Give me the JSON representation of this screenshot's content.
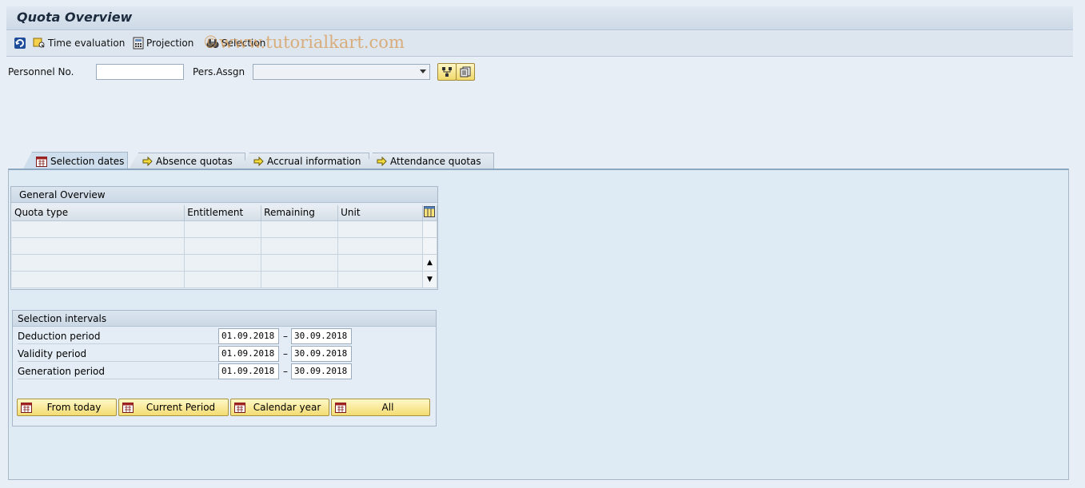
{
  "title": "Quota Overview",
  "watermark": "©www.tutorialkart.com",
  "toolbar": {
    "time_evaluation": "Time evaluation",
    "projection": "Projection",
    "selection": "Selection"
  },
  "header": {
    "personnel_label": "Personnel No.",
    "personnel_value": "",
    "assignment_label": "Pers.Assgn",
    "assignment_value": ""
  },
  "tabs": [
    {
      "label": "Selection dates",
      "active": true
    },
    {
      "label": "Absence quotas",
      "active": false
    },
    {
      "label": "Accrual information",
      "active": false
    },
    {
      "label": "Attendance quotas",
      "active": false
    }
  ],
  "overview": {
    "title": "General Overview",
    "columns": [
      "Quota type",
      "Entitlement",
      "Remaining",
      "Unit"
    ]
  },
  "intervals": {
    "title": "Selection intervals",
    "rows": [
      {
        "label": "Deduction period",
        "from": "01.09.2018",
        "to": "30.09.2018"
      },
      {
        "label": "Validity period",
        "from": "01.09.2018",
        "to": "30.09.2018"
      },
      {
        "label": "Generation period",
        "from": "01.09.2018",
        "to": "30.09.2018"
      }
    ],
    "separator": "–"
  },
  "buttons": {
    "from_today": "From today",
    "current_period": "Current Period",
    "calendar_year": "Calendar year",
    "all": "All"
  },
  "colors": {
    "background": "#e8eef5",
    "panel": "#deeaf4",
    "button_yellow": "#f3dc72"
  }
}
